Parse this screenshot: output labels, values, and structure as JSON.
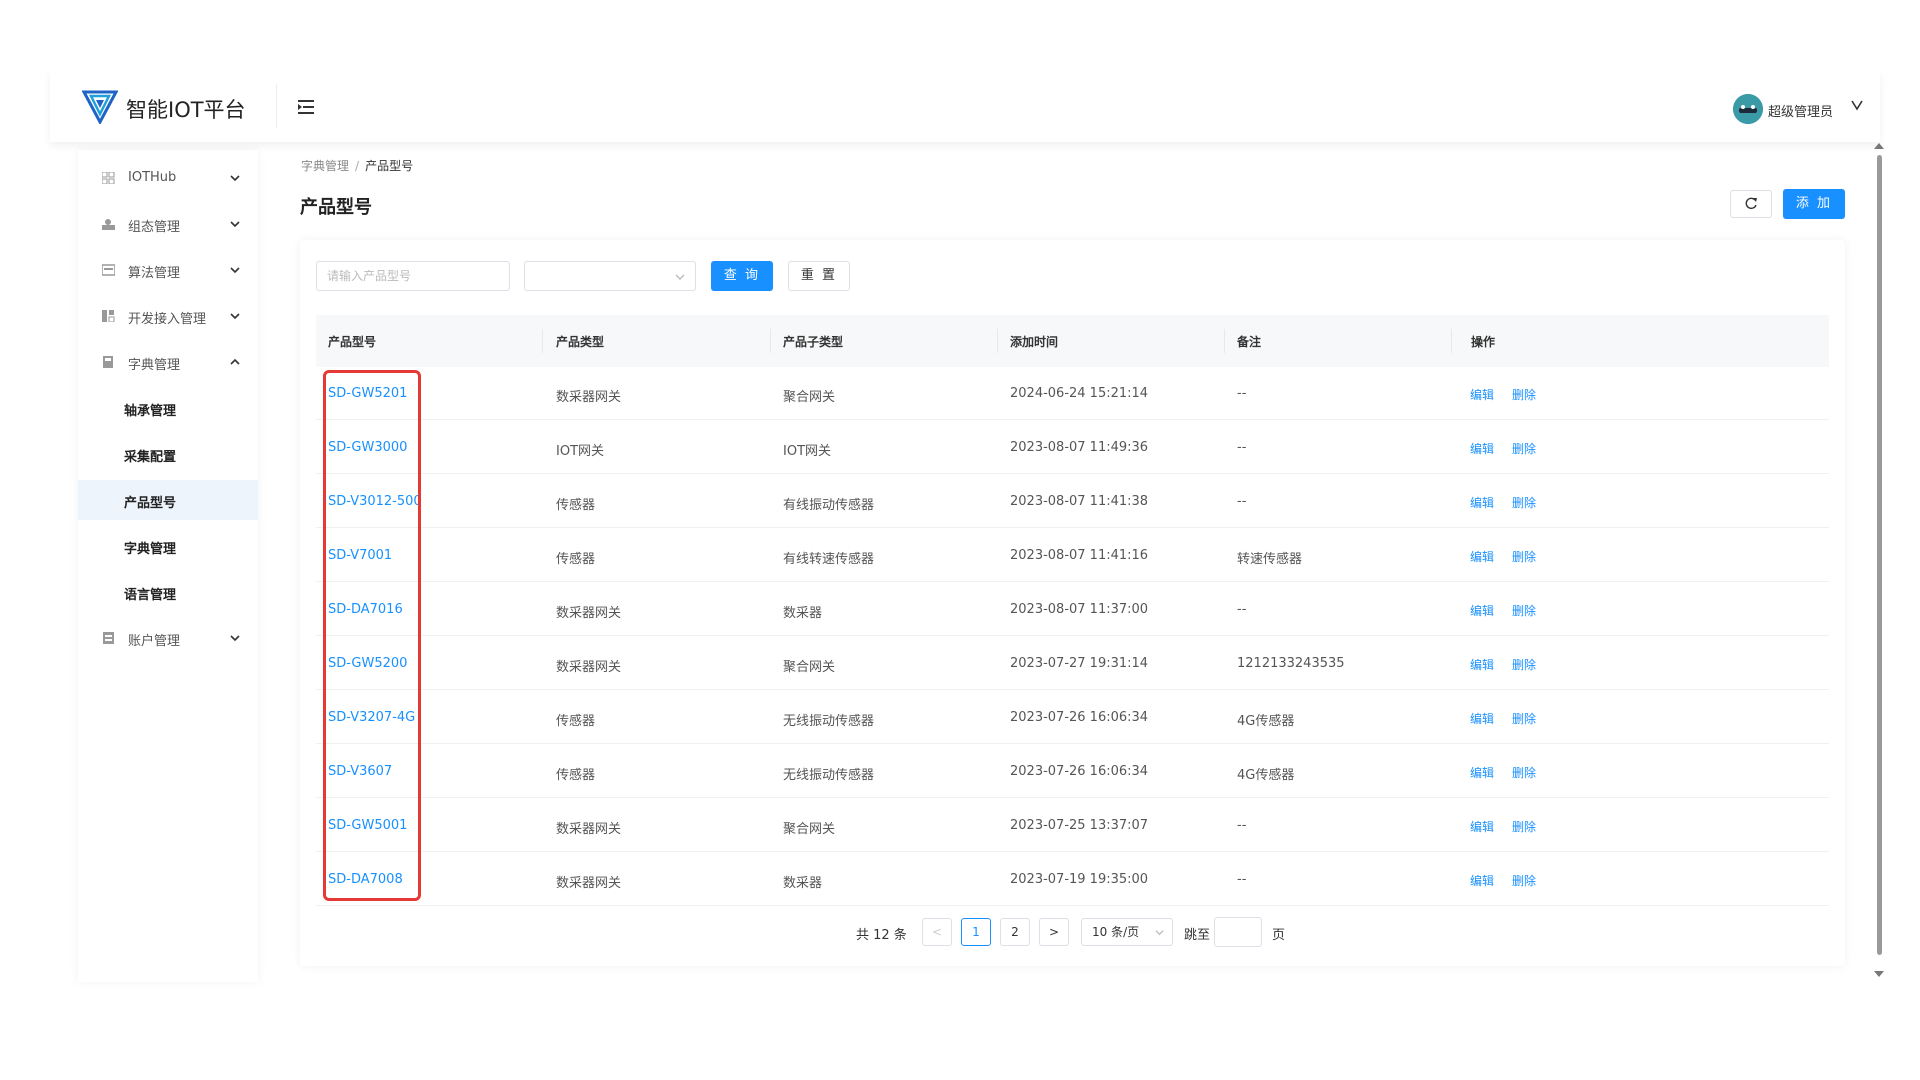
{
  "header": {
    "app_title": "智能IOT平台",
    "user_name": "超级管理员",
    "icons": {
      "logo": "v-logo-icon",
      "menu": "menu-fold-icon",
      "avatar": "avatar-icon",
      "user_menu": "chevron-down-icon"
    }
  },
  "sidebar": {
    "items": [
      {
        "label": "IOTHub",
        "icon": "grid-icon",
        "expanded": false
      },
      {
        "label": "组态管理",
        "icon": "config-icon",
        "expanded": false
      },
      {
        "label": "算法管理",
        "icon": "algorithm-icon",
        "expanded": false
      },
      {
        "label": "开发接入管理",
        "icon": "dev-access-icon",
        "expanded": false
      },
      {
        "label": "字典管理",
        "icon": "dictionary-icon",
        "expanded": true
      },
      {
        "label": "账户管理",
        "icon": "account-icon",
        "expanded": false
      }
    ],
    "sub_items": [
      {
        "label": "轴承管理",
        "active": false
      },
      {
        "label": "采集配置",
        "active": false
      },
      {
        "label": "产品型号",
        "active": true
      },
      {
        "label": "字典管理",
        "active": false
      },
      {
        "label": "语言管理",
        "active": false
      }
    ]
  },
  "breadcrumb": {
    "parent": "字典管理",
    "separator": "/",
    "current": "产品型号"
  },
  "page_title": "产品型号",
  "toolbar": {
    "add_label": "添 加",
    "refresh_icon": "refresh-icon"
  },
  "filters": {
    "model_placeholder": "请输入产品型号",
    "model_value": "",
    "type_value": "",
    "query_label": "查 询",
    "reset_label": "重 置"
  },
  "table": {
    "columns": [
      "产品型号",
      "产品类型",
      "产品子类型",
      "添加时间",
      "备注",
      "操作"
    ],
    "edit_label": "编辑",
    "delete_label": "删除",
    "rows": [
      {
        "model": "SD-GW5201",
        "type": "数采器网关",
        "subtype": "聚合网关",
        "time": "2024-06-24 15:21:14",
        "note": "--"
      },
      {
        "model": "SD-GW3000",
        "type": "IOT网关",
        "subtype": "IOT网关",
        "time": "2023-08-07 11:49:36",
        "note": "--"
      },
      {
        "model": "SD-V3012-500",
        "type": "传感器",
        "subtype": "有线振动传感器",
        "time": "2023-08-07 11:41:38",
        "note": "--"
      },
      {
        "model": "SD-V7001",
        "type": "传感器",
        "subtype": "有线转速传感器",
        "time": "2023-08-07 11:41:16",
        "note": "转速传感器"
      },
      {
        "model": "SD-DA7016",
        "type": "数采器网关",
        "subtype": "数采器",
        "time": "2023-08-07 11:37:00",
        "note": "--"
      },
      {
        "model": "SD-GW5200",
        "type": "数采器网关",
        "subtype": "聚合网关",
        "time": "2023-07-27 19:31:14",
        "note": "1212133243535"
      },
      {
        "model": "SD-V3207-4G",
        "type": "传感器",
        "subtype": "无线振动传感器",
        "time": "2023-07-26 16:06:34",
        "note": "4G传感器"
      },
      {
        "model": "SD-V3607",
        "type": "传感器",
        "subtype": "无线振动传感器",
        "time": "2023-07-26 16:06:34",
        "note": "4G传感器"
      },
      {
        "model": "SD-GW5001",
        "type": "数采器网关",
        "subtype": "聚合网关",
        "time": "2023-07-25 13:37:07",
        "note": "--"
      },
      {
        "model": "SD-DA7008",
        "type": "数采器网关",
        "subtype": "数采器",
        "time": "2023-07-19 19:35:00",
        "note": "--"
      }
    ]
  },
  "pagination": {
    "total_text": "共 12 条",
    "prev": "<",
    "pages": [
      "1",
      "2"
    ],
    "current_page": "1",
    "next": ">",
    "page_size": "10 条/页",
    "jump_label": "跳至",
    "jump_value": "",
    "page_unit": "页"
  },
  "colors": {
    "primary": "#1890ff",
    "highlight": "#e53935"
  }
}
